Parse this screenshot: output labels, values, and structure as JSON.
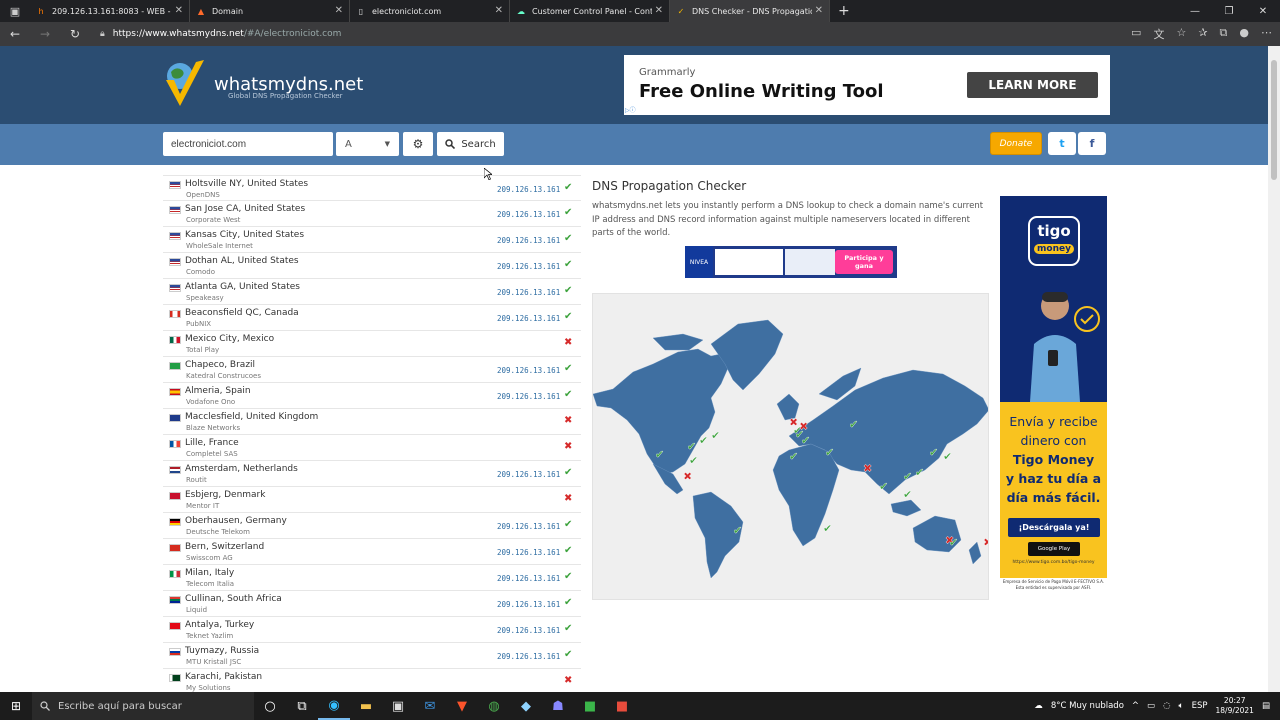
{
  "browser": {
    "tabs": [
      {
        "title": "209.126.13.161:8083 - WEB - Par",
        "active": false,
        "icon": "hestia-icon"
      },
      {
        "title": "Domain",
        "active": false,
        "icon": "domain-icon"
      },
      {
        "title": "electroniciot.com",
        "active": false,
        "icon": "page-icon"
      },
      {
        "title": "Customer Control Panel - Conta",
        "active": false,
        "icon": "cloud-icon"
      },
      {
        "title": "DNS Checker - DNS Propagation",
        "active": true,
        "icon": "dns-icon"
      }
    ],
    "url_host": "https://www.whatsmydns.net",
    "url_path": "/#A/electroniciot.com"
  },
  "site": {
    "logo_name": "whatsmydns.net",
    "logo_tagline": "Global DNS Propagation Checker",
    "ad": {
      "brand": "Grammarly",
      "headline": "Free Online Writing Tool",
      "cta": "LEARN MORE"
    },
    "search": {
      "domain_value": "electroniciot.com",
      "record_type": "A",
      "search_label": "Search"
    },
    "donate_label": "Donate",
    "twitter_label": "t",
    "facebook_label": "f",
    "heading": "DNS Propagation Checker",
    "description": "whatsmydns.net lets you instantly perform a DNS lookup to check a domain name's current IP address and DNS record information against multiple nameservers located in different parts of the world.",
    "banner": {
      "brand": "NIVEA",
      "badge": "Participa y gana"
    },
    "side_ad": {
      "brand": "tigo",
      "sub": "money",
      "line1": "Envía y recibe",
      "line2": "dinero con",
      "line3": "Tigo Money",
      "line4": "y haz tu día a",
      "line5": "día más fácil.",
      "download": "¡Descárgala ya!",
      "store": "Google Play",
      "url": "https://www.tigo.com.bo/tigo-money",
      "footer": "Empresa de Servicio de Pago Móvil E-FECTIVO S.A. Esta entidad es supervisada por ASFI."
    }
  },
  "results": [
    {
      "location": "Holtsville NY, United States",
      "provider": "OpenDNS",
      "ip": "209.126.13.161",
      "ok": true,
      "flag": "us"
    },
    {
      "location": "San Jose CA, United States",
      "provider": "Corporate West",
      "ip": "209.126.13.161",
      "ok": true,
      "flag": "us"
    },
    {
      "location": "Kansas City, United States",
      "provider": "WholeSale Internet",
      "ip": "209.126.13.161",
      "ok": true,
      "flag": "us"
    },
    {
      "location": "Dothan AL, United States",
      "provider": "Comodo",
      "ip": "209.126.13.161",
      "ok": true,
      "flag": "us"
    },
    {
      "location": "Atlanta GA, United States",
      "provider": "Speakeasy",
      "ip": "209.126.13.161",
      "ok": true,
      "flag": "us"
    },
    {
      "location": "Beaconsfield QC, Canada",
      "provider": "PubNIX",
      "ip": "209.126.13.161",
      "ok": true,
      "flag": "ca"
    },
    {
      "location": "Mexico City, Mexico",
      "provider": "Total Play",
      "ip": "",
      "ok": false,
      "flag": "mx"
    },
    {
      "location": "Chapeco, Brazil",
      "provider": "Katedral Construcoes",
      "ip": "209.126.13.161",
      "ok": true,
      "flag": "br"
    },
    {
      "location": "Almeria, Spain",
      "provider": "Vodafone Ono",
      "ip": "209.126.13.161",
      "ok": true,
      "flag": "es"
    },
    {
      "location": "Macclesfield, United Kingdom",
      "provider": "Blaze Networks",
      "ip": "",
      "ok": false,
      "flag": "gb"
    },
    {
      "location": "Lille, France",
      "provider": "Completel SAS",
      "ip": "",
      "ok": false,
      "flag": "fr"
    },
    {
      "location": "Amsterdam, Netherlands",
      "provider": "Routit",
      "ip": "209.126.13.161",
      "ok": true,
      "flag": "nl"
    },
    {
      "location": "Esbjerg, Denmark",
      "provider": "Mentor IT",
      "ip": "",
      "ok": false,
      "flag": "dk"
    },
    {
      "location": "Oberhausen, Germany",
      "provider": "Deutsche Telekom",
      "ip": "209.126.13.161",
      "ok": true,
      "flag": "de"
    },
    {
      "location": "Bern, Switzerland",
      "provider": "Swisscom AG",
      "ip": "209.126.13.161",
      "ok": true,
      "flag": "ch"
    },
    {
      "location": "Milan, Italy",
      "provider": "Telecom Italia",
      "ip": "209.126.13.161",
      "ok": true,
      "flag": "it"
    },
    {
      "location": "Cullinan, South Africa",
      "provider": "Liquid",
      "ip": "209.126.13.161",
      "ok": true,
      "flag": "za"
    },
    {
      "location": "Antalya, Turkey",
      "provider": "Teknet Yazlim",
      "ip": "209.126.13.161",
      "ok": true,
      "flag": "tr"
    },
    {
      "location": "Tuymazy, Russia",
      "provider": "MTU Kristall JSC",
      "ip": "209.126.13.161",
      "ok": true,
      "flag": "ru"
    },
    {
      "location": "Karachi, Pakistan",
      "provider": "My Solutions",
      "ip": "",
      "ok": false,
      "flag": "pk"
    }
  ],
  "taskbar": {
    "search_placeholder": "Escribe aquí para buscar",
    "weather": "8°C  Muy nublado",
    "lang": "ESP",
    "time": "20:27",
    "date": "18/9/2021"
  },
  "colors": {
    "header": "#2b4d72",
    "searchbar": "#4e7cae",
    "ok": "#3da33d",
    "fail": "#d62b2b",
    "land": "#3f6fa1"
  }
}
